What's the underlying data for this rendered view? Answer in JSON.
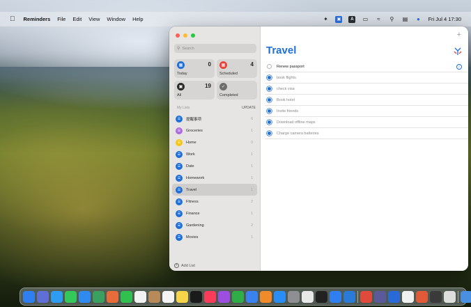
{
  "menubar": {
    "app_name": "Reminders",
    "menus": [
      "File",
      "Edit",
      "View",
      "Window",
      "Help"
    ],
    "clock": "Fri Jul 4 17:30"
  },
  "sidebar": {
    "search_placeholder": "Search",
    "smart_lists": [
      {
        "label": "Today",
        "count": "0",
        "color": "#1f6fd8",
        "icon": "calendar-icon"
      },
      {
        "label": "Scheduled",
        "count": "4",
        "color": "#e8423a",
        "icon": "calendar-icon"
      },
      {
        "label": "All",
        "count": "19",
        "color": "#2a2a2a",
        "icon": "tray-icon"
      },
      {
        "label": "Completed",
        "count": "",
        "color": "#6e6e6e",
        "icon": "checkmark-icon"
      }
    ],
    "my_lists_header": "My Lists",
    "update_label": "UPDATE",
    "lists": [
      {
        "name": "提醒事项",
        "count": "6",
        "color": "#1f6fd8"
      },
      {
        "name": "Groceries",
        "count": "1",
        "color": "#b06ae0"
      },
      {
        "name": "Home",
        "count": "0",
        "color": "#f5c518"
      },
      {
        "name": "Work",
        "count": "1",
        "color": "#1f6fd8"
      },
      {
        "name": "Date",
        "count": "1",
        "color": "#1f6fd8"
      },
      {
        "name": "Homework",
        "count": "1",
        "color": "#1f6fd8"
      },
      {
        "name": "Travel",
        "count": "1",
        "color": "#1f6fd8"
      },
      {
        "name": "Fitness",
        "count": "2",
        "color": "#1f6fd8"
      },
      {
        "name": "Finance",
        "count": "1",
        "color": "#1f6fd8"
      },
      {
        "name": "Gardening",
        "count": "2",
        "color": "#1f6fd8"
      },
      {
        "name": "Movies",
        "count": "1",
        "color": "#1f6fd8"
      }
    ],
    "active_list_index": 6,
    "add_list_label": "Add List"
  },
  "detail": {
    "title": "Travel",
    "add_symbol": "+",
    "reminders": [
      {
        "text": "Renew passport",
        "completed": false
      },
      {
        "text": "book flights",
        "completed": true
      },
      {
        "text": "check visa",
        "completed": true
      },
      {
        "text": "Book hotel",
        "completed": true
      },
      {
        "text": "Invite friends",
        "completed": true
      },
      {
        "text": "Download offline maps",
        "completed": true
      },
      {
        "text": "Charge camera batteries",
        "completed": true
      }
    ]
  },
  "dock": {
    "apps": [
      {
        "name": "finder-icon",
        "color": "#2f7ff0"
      },
      {
        "name": "launchpad-icon",
        "color": "#5f6fd6"
      },
      {
        "name": "safari-icon",
        "color": "#2e9cf0"
      },
      {
        "name": "messages-icon",
        "color": "#34c759"
      },
      {
        "name": "mail-icon",
        "color": "#2f8bf0"
      },
      {
        "name": "maps-icon",
        "color": "#3aa060"
      },
      {
        "name": "photos-icon",
        "color": "#e86c3a"
      },
      {
        "name": "facetime-icon",
        "color": "#30c050"
      },
      {
        "name": "calendar-icon",
        "color": "#f2f2f2"
      },
      {
        "name": "contacts-icon",
        "color": "#b88a5a"
      },
      {
        "name": "reminders-icon",
        "color": "#f4f4f4"
      },
      {
        "name": "notes-icon",
        "color": "#f5d44a"
      },
      {
        "name": "tv-icon",
        "color": "#1a1a1a"
      },
      {
        "name": "music-icon",
        "color": "#fa3c5a"
      },
      {
        "name": "podcasts-icon",
        "color": "#9b4ee0"
      },
      {
        "name": "numbers-icon",
        "color": "#2fae48"
      },
      {
        "name": "keynote-icon",
        "color": "#3a82f0"
      },
      {
        "name": "pages-icon",
        "color": "#f08a2a"
      },
      {
        "name": "appstore-icon",
        "color": "#2a8cf5"
      },
      {
        "name": "settings-icon",
        "color": "#8e8e93"
      },
      {
        "name": "chrome-icon",
        "color": "#e8e8e8"
      },
      {
        "name": "terminal-icon",
        "color": "#222222"
      },
      {
        "name": "xcode-icon",
        "color": "#2f7ff0"
      },
      {
        "name": "vscode-icon",
        "color": "#2a7ad8"
      },
      {
        "name": "app-icon",
        "color": "#e04a3a"
      },
      {
        "name": "app-icon",
        "color": "#5a5a9a"
      },
      {
        "name": "app-icon",
        "color": "#2a6ad8"
      },
      {
        "name": "preview-icon",
        "color": "#f0f0f0"
      },
      {
        "name": "app-icon",
        "color": "#e05a3a"
      },
      {
        "name": "app-icon",
        "color": "#3a3a3a"
      },
      {
        "name": "app-icon",
        "color": "#dddddd"
      },
      {
        "name": "downloads-icon",
        "color": "#4a90e2"
      },
      {
        "name": "trash-icon",
        "color": "#c8ccd0"
      }
    ]
  }
}
